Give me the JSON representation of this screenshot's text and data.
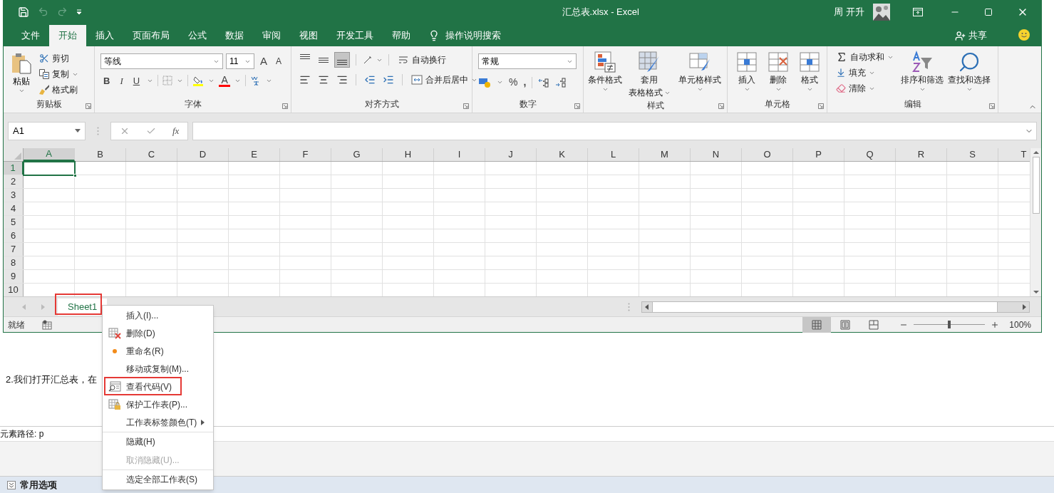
{
  "window": {
    "title": "汇总表.xlsx - Excel",
    "user": "周 开升"
  },
  "ribbon_tabs": [
    {
      "label": "文件",
      "selected": false
    },
    {
      "label": "开始",
      "selected": true
    },
    {
      "label": "插入",
      "selected": false
    },
    {
      "label": "页面布局",
      "selected": false
    },
    {
      "label": "公式",
      "selected": false
    },
    {
      "label": "数据",
      "selected": false
    },
    {
      "label": "审阅",
      "selected": false
    },
    {
      "label": "视图",
      "selected": false
    },
    {
      "label": "开发工具",
      "selected": false
    },
    {
      "label": "帮助",
      "selected": false
    }
  ],
  "tell_me": "操作说明搜索",
  "share": "共享",
  "ribbon": {
    "clipboard": {
      "label": "剪贴板",
      "paste": "粘贴",
      "cut": "剪切",
      "copy": "复制",
      "painter": "格式刷"
    },
    "font": {
      "label": "字体",
      "font_name": "等线",
      "font_size": "11",
      "grow": "A",
      "shrink": "A",
      "bold": "B",
      "italic": "I",
      "underline": "U",
      "font_color": "A"
    },
    "alignment": {
      "label": "对齐方式",
      "vertical": [
        {
          "selected": false
        },
        {
          "selected": false
        },
        {
          "selected": true
        }
      ],
      "wrap": "自动换行",
      "merge": "合并后居中"
    },
    "number": {
      "label": "数字",
      "format": "常规",
      "percent": "%",
      "comma": ","
    },
    "styles": {
      "label": "样式",
      "conditional": "条件格式",
      "table_1": "套用",
      "table_2": "表格格式",
      "cell_styles": "单元格样式"
    },
    "cells": {
      "label": "单元格",
      "insert": "插入",
      "delete": "删除",
      "format": "格式"
    },
    "editing": {
      "label": "编辑",
      "autosum": "自动求和",
      "fill": "填充",
      "clear": "清除",
      "sort": "排序和筛选",
      "find": "查找和选择"
    }
  },
  "formula_bar": {
    "name_box": "A1",
    "fx": "fx"
  },
  "sheet": {
    "columns": [
      {
        "label": "A",
        "selected": true
      },
      {
        "label": "B",
        "selected": false
      },
      {
        "label": "C",
        "selected": false
      },
      {
        "label": "D",
        "selected": false
      },
      {
        "label": "E",
        "selected": false
      },
      {
        "label": "F",
        "selected": false
      },
      {
        "label": "G",
        "selected": false
      },
      {
        "label": "H",
        "selected": false
      },
      {
        "label": "I",
        "selected": false
      },
      {
        "label": "J",
        "selected": false
      },
      {
        "label": "K",
        "selected": false
      },
      {
        "label": "L",
        "selected": false
      },
      {
        "label": "M",
        "selected": false
      },
      {
        "label": "N",
        "selected": false
      },
      {
        "label": "O",
        "selected": false
      },
      {
        "label": "P",
        "selected": false
      },
      {
        "label": "Q",
        "selected": false
      },
      {
        "label": "R",
        "selected": false
      },
      {
        "label": "S",
        "selected": false
      },
      {
        "label": "T",
        "selected": false
      }
    ],
    "rows": [
      {
        "label": "1",
        "selected": true
      },
      {
        "label": "2",
        "selected": false
      },
      {
        "label": "3",
        "selected": false
      },
      {
        "label": "4",
        "selected": false
      },
      {
        "label": "5",
        "selected": false
      },
      {
        "label": "6",
        "selected": false
      },
      {
        "label": "7",
        "selected": false
      },
      {
        "label": "8",
        "selected": false
      },
      {
        "label": "9",
        "selected": false
      },
      {
        "label": "10",
        "selected": false
      }
    ]
  },
  "sheet_tabs": [
    {
      "label": "Sheet1",
      "selected": true,
      "annotated": true
    }
  ],
  "status_bar": {
    "ready": "就绪",
    "views": [
      {
        "selected": true
      },
      {
        "selected": false
      },
      {
        "selected": false
      }
    ],
    "zoom": {
      "level": 0.5
    },
    "zoom_text": "100%"
  },
  "context_menu": [
    {
      "label": "插入(I)...",
      "disabled": false,
      "separator_before": false,
      "submenu": false,
      "annotated": false
    },
    {
      "label": "删除(D)",
      "disabled": false,
      "separator_before": false,
      "submenu": false,
      "annotated": false
    },
    {
      "label": "重命名(R)",
      "disabled": false,
      "separator_before": false,
      "submenu": false,
      "annotated": false
    },
    {
      "label": "移动或复制(M)...",
      "disabled": false,
      "separator_before": false,
      "submenu": false,
      "annotated": false
    },
    {
      "label": "查看代码(V)",
      "disabled": false,
      "separator_before": false,
      "submenu": false,
      "annotated": true
    },
    {
      "label": "保护工作表(P)...",
      "disabled": false,
      "separator_before": false,
      "submenu": false,
      "annotated": false
    },
    {
      "label": "工作表标签颜色(T)",
      "disabled": false,
      "separator_before": false,
      "submenu": true,
      "annotated": false
    },
    {
      "label": "隐藏(H)",
      "disabled": false,
      "separator_before": true,
      "submenu": false,
      "annotated": false
    },
    {
      "label": "取消隐藏(U)...",
      "disabled": true,
      "separator_before": false,
      "submenu": false,
      "annotated": false
    },
    {
      "label": "选定全部工作表(S)",
      "disabled": false,
      "separator_before": true,
      "submenu": false,
      "annotated": false
    }
  ],
  "page": {
    "paragraph": "2.我们打开汇总表，在",
    "element_path": "元素路径: p",
    "panel_title": "常用选项"
  }
}
